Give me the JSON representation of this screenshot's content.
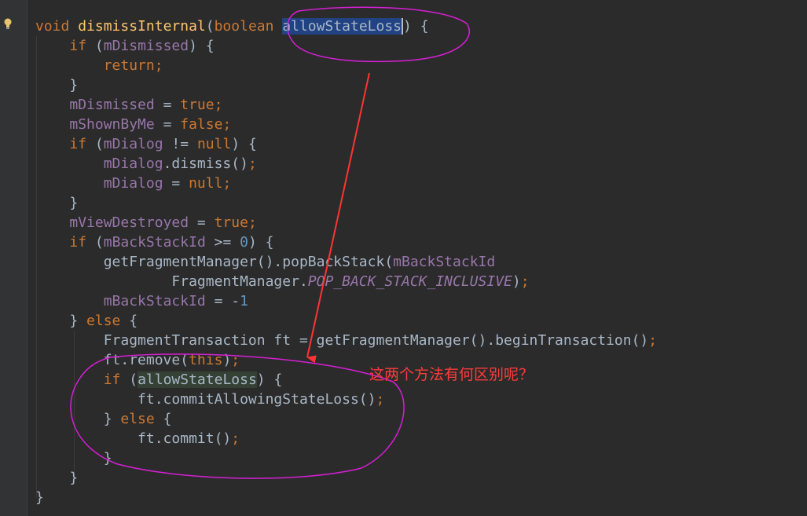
{
  "editor": {
    "code_lines": [
      "void dismissInternal(boolean allowStateLoss) {",
      "    if (mDismissed) {",
      "        return;",
      "    }",
      "    mDismissed = true;",
      "    mShownByMe = false;",
      "    if (mDialog != null) {",
      "        mDialog.dismiss();",
      "        mDialog = null;",
      "    }",
      "    mViewDestroyed = true;",
      "    if (mBackStackId >= 0) {",
      "        getFragmentManager().popBackStack(mBackStackId,",
      "                FragmentManager.POP_BACK_STACK_INCLUSIVE);",
      "        mBackStackId = -1;",
      "    } else {",
      "        FragmentTransaction ft = getFragmentManager().beginTransaction();",
      "        ft.remove(this);",
      "        if (allowStateLoss) {",
      "            ft.commitAllowingStateLoss();",
      "        } else {",
      "            ft.commit();",
      "        }",
      "    }",
      "}"
    ],
    "gutter_icon": "lightbulb-icon",
    "colors": {
      "background": "#2b2b2b",
      "keyword": "#cc7832",
      "method_declaration": "#ffc66d",
      "field": "#9876aa",
      "number": "#6897bb",
      "default_text": "#a9b7c6",
      "selection": "#214283"
    }
  },
  "annotation": {
    "question": "这两个方法有何区别呢？",
    "ellipse_color": "#d61fd6",
    "arrow_color": "#ff3333"
  }
}
